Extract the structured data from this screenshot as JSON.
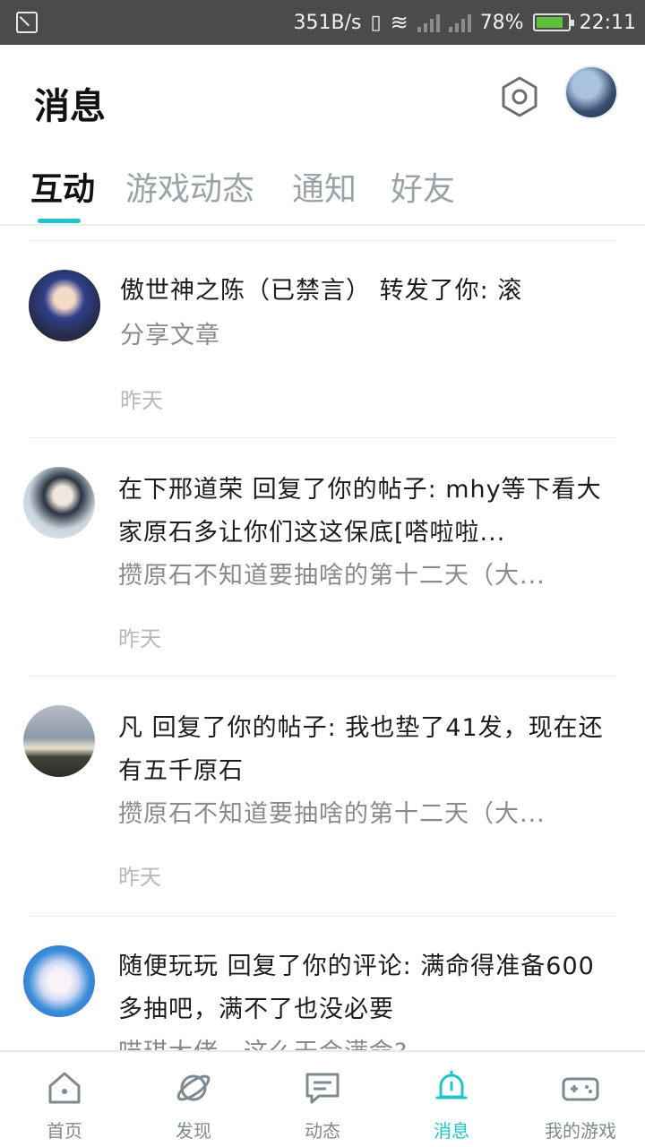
{
  "status_bar": {
    "speed": "351B/s",
    "battery": "78%",
    "time": "22:11"
  },
  "header": {
    "title": "消息"
  },
  "tabs": [
    {
      "label": "互动",
      "active": true
    },
    {
      "label": "游戏动态",
      "active": false
    },
    {
      "label": "通知",
      "active": false
    },
    {
      "label": "好友",
      "active": false
    }
  ],
  "messages": [
    {
      "title": "傲世神之陈（已禁言） 转发了你: 滚",
      "subtitle": "分享文章",
      "time": "昨天"
    },
    {
      "title": "在下邢道荣 回复了你的帖子: mhy等下看大家原石多让你们这这保底[嗒啦啦...",
      "subtitle": "攒原石不知道要抽啥的第十二天（大...",
      "time": "昨天"
    },
    {
      "title": "凡 回复了你的帖子: 我也垫了41发，现在还有五千原石",
      "subtitle": "攒原石不知道要抽啥的第十二天（大...",
      "time": "昨天"
    },
    {
      "title": "随便玩玩 回复了你的评论: 满命得准备600多抽吧，满不了也没必要",
      "subtitle": "喵琪大佬，这么天会满命?",
      "time": ""
    }
  ],
  "bottom_nav": [
    {
      "label": "首页",
      "icon": "home-icon",
      "active": false
    },
    {
      "label": "发现",
      "icon": "planet-icon",
      "active": false
    },
    {
      "label": "动态",
      "icon": "chat-icon",
      "active": false
    },
    {
      "label": "消息",
      "icon": "bell-icon",
      "active": true
    },
    {
      "label": "我的游戏",
      "icon": "gamepad-icon",
      "active": false
    }
  ],
  "colors": {
    "accent": "#20c5c7",
    "inactive": "#7f8a90"
  }
}
